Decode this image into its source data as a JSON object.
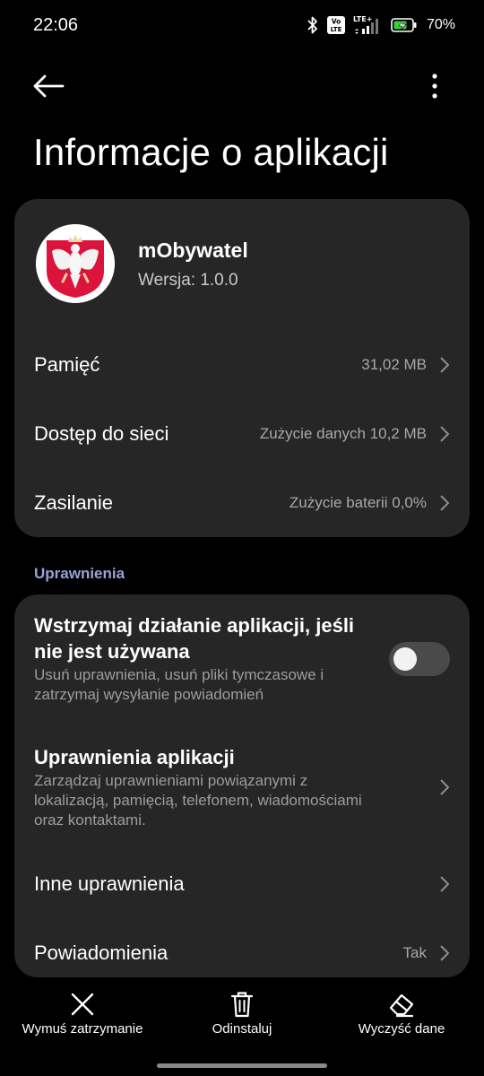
{
  "status_bar": {
    "time": "22:06",
    "battery_percent": "70%",
    "volte_badge_line1": "Vo",
    "volte_badge_line2": "LTE",
    "network_label": "LTE+",
    "icons": [
      "bluetooth-icon",
      "volte-icon",
      "signal-icon",
      "battery-charging-icon"
    ]
  },
  "header": {
    "title": "Informacje o aplikacji"
  },
  "app": {
    "name": "mObywatel",
    "version": "Wersja: 1.0.0",
    "icon": "polish-eagle-emblem"
  },
  "details": [
    {
      "label": "Pamięć",
      "value": "31,02 MB"
    },
    {
      "label": "Dostęp do sieci",
      "value": "Zużycie danych 10,2 MB"
    },
    {
      "label": "Zasilanie",
      "value": "Zużycie baterii 0,0%"
    }
  ],
  "permissions": {
    "section_title": "Uprawnienia",
    "pause_app": {
      "title_line1": "Wstrzymaj działanie aplikacji, jeśli",
      "title_line2": "nie jest używana",
      "desc_line1": "Usuń uprawnienia, usuń pliki tymczasowe i",
      "desc_line2": "zatrzymaj wysyłanie powiadomień",
      "enabled": false
    },
    "app_permissions": {
      "title": "Uprawnienia aplikacji",
      "desc_line1": "Zarządzaj uprawnieniami powiązanymi z",
      "desc_line2": "lokalizacją, pamięcią, telefonem, wiadomościami",
      "desc_line3": "oraz kontaktami."
    },
    "other_permissions": {
      "title": "Inne uprawnienia"
    },
    "notifications": {
      "title": "Powiadomienia",
      "value": "Tak"
    }
  },
  "bottom_actions": {
    "force_stop": "Wymuś zatrzymanie",
    "uninstall": "Odinstaluj",
    "clear_data": "Wyczyść dane"
  },
  "colors": {
    "background": "#000000",
    "card": "#262626",
    "section_accent": "#9aa3d6",
    "secondary_text": "#a8a8a8",
    "emblem_red": "#dc143c"
  }
}
